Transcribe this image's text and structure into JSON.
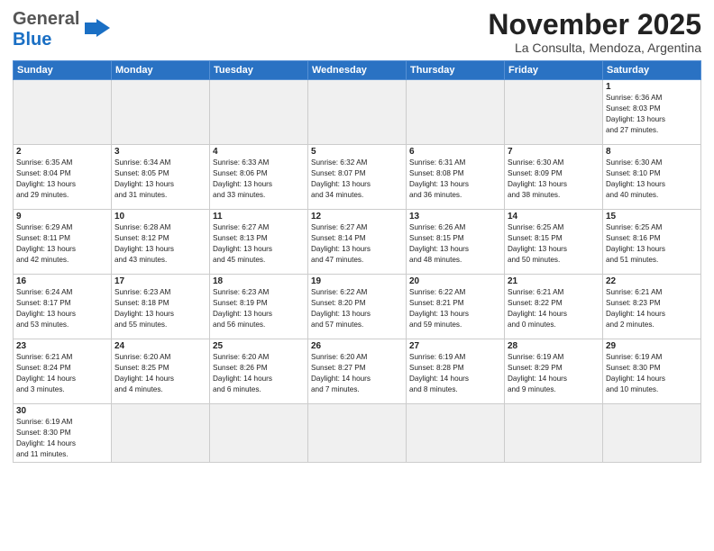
{
  "header": {
    "logo_general": "General",
    "logo_blue": "Blue",
    "title": "November 2025",
    "subtitle": "La Consulta, Mendoza, Argentina"
  },
  "weekdays": [
    "Sunday",
    "Monday",
    "Tuesday",
    "Wednesday",
    "Thursday",
    "Friday",
    "Saturday"
  ],
  "weeks": [
    [
      {
        "day": "",
        "info": ""
      },
      {
        "day": "",
        "info": ""
      },
      {
        "day": "",
        "info": ""
      },
      {
        "day": "",
        "info": ""
      },
      {
        "day": "",
        "info": ""
      },
      {
        "day": "",
        "info": ""
      },
      {
        "day": "1",
        "info": "Sunrise: 6:36 AM\nSunset: 8:03 PM\nDaylight: 13 hours\nand 27 minutes."
      }
    ],
    [
      {
        "day": "2",
        "info": "Sunrise: 6:35 AM\nSunset: 8:04 PM\nDaylight: 13 hours\nand 29 minutes."
      },
      {
        "day": "3",
        "info": "Sunrise: 6:34 AM\nSunset: 8:05 PM\nDaylight: 13 hours\nand 31 minutes."
      },
      {
        "day": "4",
        "info": "Sunrise: 6:33 AM\nSunset: 8:06 PM\nDaylight: 13 hours\nand 33 minutes."
      },
      {
        "day": "5",
        "info": "Sunrise: 6:32 AM\nSunset: 8:07 PM\nDaylight: 13 hours\nand 34 minutes."
      },
      {
        "day": "6",
        "info": "Sunrise: 6:31 AM\nSunset: 8:08 PM\nDaylight: 13 hours\nand 36 minutes."
      },
      {
        "day": "7",
        "info": "Sunrise: 6:30 AM\nSunset: 8:09 PM\nDaylight: 13 hours\nand 38 minutes."
      },
      {
        "day": "8",
        "info": "Sunrise: 6:30 AM\nSunset: 8:10 PM\nDaylight: 13 hours\nand 40 minutes."
      }
    ],
    [
      {
        "day": "9",
        "info": "Sunrise: 6:29 AM\nSunset: 8:11 PM\nDaylight: 13 hours\nand 42 minutes."
      },
      {
        "day": "10",
        "info": "Sunrise: 6:28 AM\nSunset: 8:12 PM\nDaylight: 13 hours\nand 43 minutes."
      },
      {
        "day": "11",
        "info": "Sunrise: 6:27 AM\nSunset: 8:13 PM\nDaylight: 13 hours\nand 45 minutes."
      },
      {
        "day": "12",
        "info": "Sunrise: 6:27 AM\nSunset: 8:14 PM\nDaylight: 13 hours\nand 47 minutes."
      },
      {
        "day": "13",
        "info": "Sunrise: 6:26 AM\nSunset: 8:15 PM\nDaylight: 13 hours\nand 48 minutes."
      },
      {
        "day": "14",
        "info": "Sunrise: 6:25 AM\nSunset: 8:15 PM\nDaylight: 13 hours\nand 50 minutes."
      },
      {
        "day": "15",
        "info": "Sunrise: 6:25 AM\nSunset: 8:16 PM\nDaylight: 13 hours\nand 51 minutes."
      }
    ],
    [
      {
        "day": "16",
        "info": "Sunrise: 6:24 AM\nSunset: 8:17 PM\nDaylight: 13 hours\nand 53 minutes."
      },
      {
        "day": "17",
        "info": "Sunrise: 6:23 AM\nSunset: 8:18 PM\nDaylight: 13 hours\nand 55 minutes."
      },
      {
        "day": "18",
        "info": "Sunrise: 6:23 AM\nSunset: 8:19 PM\nDaylight: 13 hours\nand 56 minutes."
      },
      {
        "day": "19",
        "info": "Sunrise: 6:22 AM\nSunset: 8:20 PM\nDaylight: 13 hours\nand 57 minutes."
      },
      {
        "day": "20",
        "info": "Sunrise: 6:22 AM\nSunset: 8:21 PM\nDaylight: 13 hours\nand 59 minutes."
      },
      {
        "day": "21",
        "info": "Sunrise: 6:21 AM\nSunset: 8:22 PM\nDaylight: 14 hours\nand 0 minutes."
      },
      {
        "day": "22",
        "info": "Sunrise: 6:21 AM\nSunset: 8:23 PM\nDaylight: 14 hours\nand 2 minutes."
      }
    ],
    [
      {
        "day": "23",
        "info": "Sunrise: 6:21 AM\nSunset: 8:24 PM\nDaylight: 14 hours\nand 3 minutes."
      },
      {
        "day": "24",
        "info": "Sunrise: 6:20 AM\nSunset: 8:25 PM\nDaylight: 14 hours\nand 4 minutes."
      },
      {
        "day": "25",
        "info": "Sunrise: 6:20 AM\nSunset: 8:26 PM\nDaylight: 14 hours\nand 6 minutes."
      },
      {
        "day": "26",
        "info": "Sunrise: 6:20 AM\nSunset: 8:27 PM\nDaylight: 14 hours\nand 7 minutes."
      },
      {
        "day": "27",
        "info": "Sunrise: 6:19 AM\nSunset: 8:28 PM\nDaylight: 14 hours\nand 8 minutes."
      },
      {
        "day": "28",
        "info": "Sunrise: 6:19 AM\nSunset: 8:29 PM\nDaylight: 14 hours\nand 9 minutes."
      },
      {
        "day": "29",
        "info": "Sunrise: 6:19 AM\nSunset: 8:30 PM\nDaylight: 14 hours\nand 10 minutes."
      }
    ],
    [
      {
        "day": "30",
        "info": "Sunrise: 6:19 AM\nSunset: 8:30 PM\nDaylight: 14 hours\nand 11 minutes."
      },
      {
        "day": "",
        "info": ""
      },
      {
        "day": "",
        "info": ""
      },
      {
        "day": "",
        "info": ""
      },
      {
        "day": "",
        "info": ""
      },
      {
        "day": "",
        "info": ""
      },
      {
        "day": "",
        "info": ""
      }
    ]
  ]
}
